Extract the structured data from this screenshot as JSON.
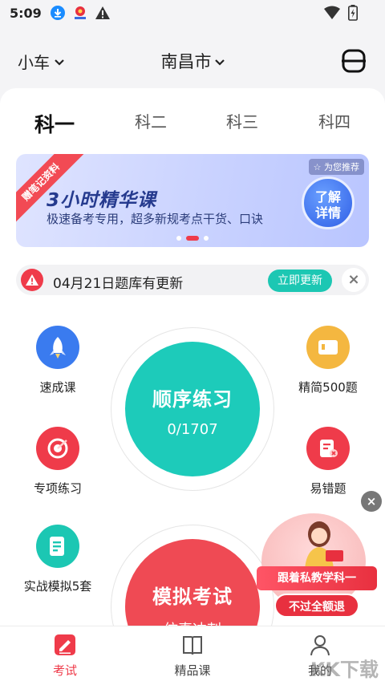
{
  "status_bar": {
    "time": "5:09"
  },
  "header": {
    "vehicle": "小车",
    "city": "南昌市"
  },
  "tabs": [
    {
      "label": "科一",
      "active": true
    },
    {
      "label": "科二",
      "active": false
    },
    {
      "label": "科三",
      "active": false
    },
    {
      "label": "科四",
      "active": false
    }
  ],
  "banner": {
    "ribbon": "赠笔记资料",
    "badge": "为您推荐",
    "title": "3小时精华课",
    "subtitle": "极速备考专用，超多新规考点干货、口诀",
    "button_line1": "了解",
    "button_line2": "详情",
    "page_index": 2,
    "page_count": 3
  },
  "notice": {
    "text": "04月21日题库有更新",
    "button": "立即更新"
  },
  "features": {
    "left": [
      "速成课",
      "专项练习",
      "实战模拟5套"
    ],
    "right": [
      "精简500题",
      "易错题"
    ]
  },
  "practice": {
    "title": "顺序练习",
    "progress": "0/1707"
  },
  "exam": {
    "title": "模拟考试",
    "subtitle": "仿真冲刺"
  },
  "promo": {
    "line1": "跟着私教学科一",
    "line2": "不过全额退"
  },
  "bottom_nav": [
    {
      "label": "考试",
      "active": true
    },
    {
      "label": "精品课",
      "active": false
    },
    {
      "label": "我的",
      "active": false
    }
  ],
  "watermark": "KK下载",
  "colors": {
    "accent": "#ef3b4a",
    "teal": "#1cc7b3",
    "blue": "#3a7bef"
  }
}
